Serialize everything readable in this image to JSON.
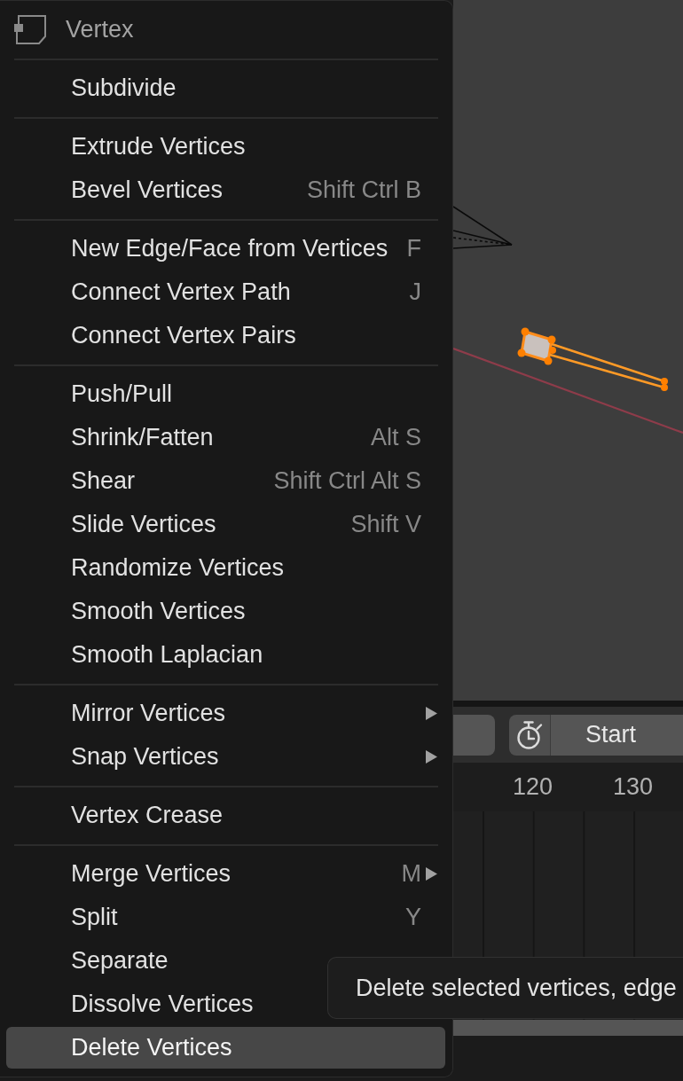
{
  "menu": {
    "title": "Vertex",
    "sections": [
      {
        "items": [
          {
            "label": "Subdivide",
            "selected": false,
            "submenu": false
          }
        ]
      },
      {
        "items": [
          {
            "label": "Extrude Vertices",
            "selected": false,
            "submenu": false
          },
          {
            "label": "Bevel Vertices",
            "shortcut": "Shift Ctrl B",
            "selected": false,
            "submenu": false
          }
        ]
      },
      {
        "items": [
          {
            "label": "New Edge/Face from Vertices",
            "shortcut": "F",
            "selected": false,
            "submenu": false
          },
          {
            "label": "Connect Vertex Path",
            "shortcut": "J",
            "selected": false,
            "submenu": false
          },
          {
            "label": "Connect Vertex Pairs",
            "selected": false,
            "submenu": false
          }
        ]
      },
      {
        "items": [
          {
            "label": "Push/Pull",
            "selected": false,
            "submenu": false
          },
          {
            "label": "Shrink/Fatten",
            "shortcut": "Alt S",
            "selected": false,
            "submenu": false
          },
          {
            "label": "Shear",
            "shortcut": "Shift Ctrl Alt S",
            "selected": false,
            "submenu": false
          },
          {
            "label": "Slide Vertices",
            "shortcut": "Shift V",
            "selected": false,
            "submenu": false
          },
          {
            "label": "Randomize Vertices",
            "selected": false,
            "submenu": false
          },
          {
            "label": "Smooth Vertices",
            "selected": false,
            "submenu": false
          },
          {
            "label": "Smooth Laplacian",
            "selected": false,
            "submenu": false
          }
        ]
      },
      {
        "items": [
          {
            "label": "Mirror Vertices",
            "selected": false,
            "submenu": true
          },
          {
            "label": "Snap Vertices",
            "selected": false,
            "submenu": true
          }
        ]
      },
      {
        "items": [
          {
            "label": "Vertex Crease",
            "selected": false,
            "submenu": false
          }
        ]
      },
      {
        "items": [
          {
            "label": "Merge Vertices",
            "shortcut": "M",
            "selected": false,
            "submenu": true
          },
          {
            "label": "Split",
            "shortcut": "Y",
            "selected": false,
            "submenu": false
          },
          {
            "label": "Separate",
            "selected": false,
            "submenu": false
          },
          {
            "label": "Dissolve Vertices",
            "selected": false,
            "submenu": false
          },
          {
            "label": "Delete Vertices",
            "selected": true,
            "submenu": false
          }
        ]
      }
    ]
  },
  "timeline": {
    "start_label": "Start",
    "ruler": [
      "120",
      "130"
    ]
  },
  "tooltip": {
    "text": "Delete selected vertices, edge"
  }
}
